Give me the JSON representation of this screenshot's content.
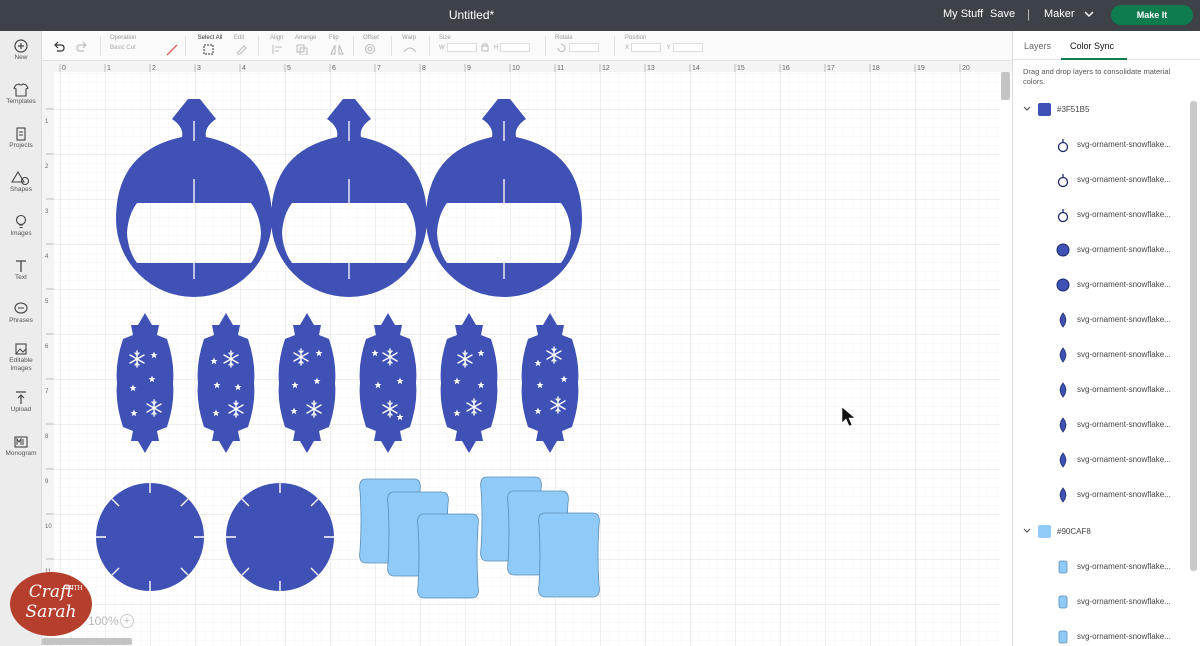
{
  "header": {
    "title": "Untitled*",
    "my_stuff": "My Stuff",
    "save": "Save",
    "separator": "|",
    "machine": "Maker",
    "make_it": "Make It"
  },
  "left_toolbar": [
    {
      "label": "New",
      "icon": "plus-circle-icon"
    },
    {
      "label": "Templates",
      "icon": "shirt-icon"
    },
    {
      "label": "Projects",
      "icon": "clipboard-icon"
    },
    {
      "label": "Shapes",
      "icon": "shapes-icon"
    },
    {
      "label": "Images",
      "icon": "lightbulb-icon"
    },
    {
      "label": "Text",
      "icon": "text-icon"
    },
    {
      "label": "Phrases",
      "icon": "speech-bubble-icon"
    },
    {
      "label": "Editable Images",
      "icon": "editable-images-icon"
    },
    {
      "label": "Upload",
      "icon": "upload-icon"
    },
    {
      "label": "Monogram",
      "icon": "monogram-icon"
    }
  ],
  "edit_toolbar": {
    "operation_label": "Operation",
    "operation_value": "Basic Cut",
    "select_all": "Select All",
    "edit": "Edit",
    "align": "Align",
    "arrange": "Arrange",
    "flip": "Flip",
    "offset": "Offset",
    "warp": "Warp",
    "size": "Size",
    "size_w": "W",
    "size_h": "H",
    "rotate": "Rotate",
    "position": "Position",
    "pos_x": "X",
    "pos_y": "Y"
  },
  "canvas": {
    "ruler_top": [
      "0",
      "1",
      "2",
      "3",
      "4",
      "5",
      "6",
      "7",
      "8",
      "9",
      "10",
      "11",
      "12",
      "13",
      "14",
      "15",
      "16",
      "17",
      "18",
      "19",
      "20"
    ],
    "ruler_left": [
      "1",
      "2",
      "3",
      "4",
      "5",
      "6",
      "7",
      "8",
      "9",
      "10",
      "11"
    ],
    "colors": {
      "dark_blue": "#3F51B5",
      "light_blue": "#90CAF8"
    },
    "zoom": "100%",
    "zoom_plus": "+"
  },
  "panel": {
    "tabs": {
      "layers": "Layers",
      "color_sync": "Color Sync"
    },
    "hint": "Drag and drop layers to consolidate material colors.",
    "groups": [
      {
        "hex": "#3F51B5",
        "color": "#3F51B5",
        "layers": [
          {
            "name": "svg-ornament-snowflake...",
            "icon": "ornament-ring-icon"
          },
          {
            "name": "svg-ornament-snowflake...",
            "icon": "ornament-ring-icon"
          },
          {
            "name": "svg-ornament-snowflake...",
            "icon": "ornament-ring-icon"
          },
          {
            "name": "svg-ornament-snowflake...",
            "icon": "circle-icon"
          },
          {
            "name": "svg-ornament-snowflake...",
            "icon": "circle-icon"
          },
          {
            "name": "svg-ornament-snowflake...",
            "icon": "panel-icon"
          },
          {
            "name": "svg-ornament-snowflake...",
            "icon": "panel-icon"
          },
          {
            "name": "svg-ornament-snowflake...",
            "icon": "panel-icon"
          },
          {
            "name": "svg-ornament-snowflake...",
            "icon": "panel-icon"
          },
          {
            "name": "svg-ornament-snowflake...",
            "icon": "panel-icon"
          },
          {
            "name": "svg-ornament-snowflake...",
            "icon": "panel-icon"
          }
        ]
      },
      {
        "hex": "#90CAF8",
        "color": "#90CAF8",
        "layers": [
          {
            "name": "svg-ornament-snowflake...",
            "icon": "tab-icon"
          },
          {
            "name": "svg-ornament-snowflake...",
            "icon": "tab-icon"
          },
          {
            "name": "svg-ornament-snowflake...",
            "icon": "tab-icon"
          }
        ]
      }
    ]
  },
  "watermark": {
    "line1": "Craft",
    "line2": "Sarah",
    "with": "WITH"
  }
}
